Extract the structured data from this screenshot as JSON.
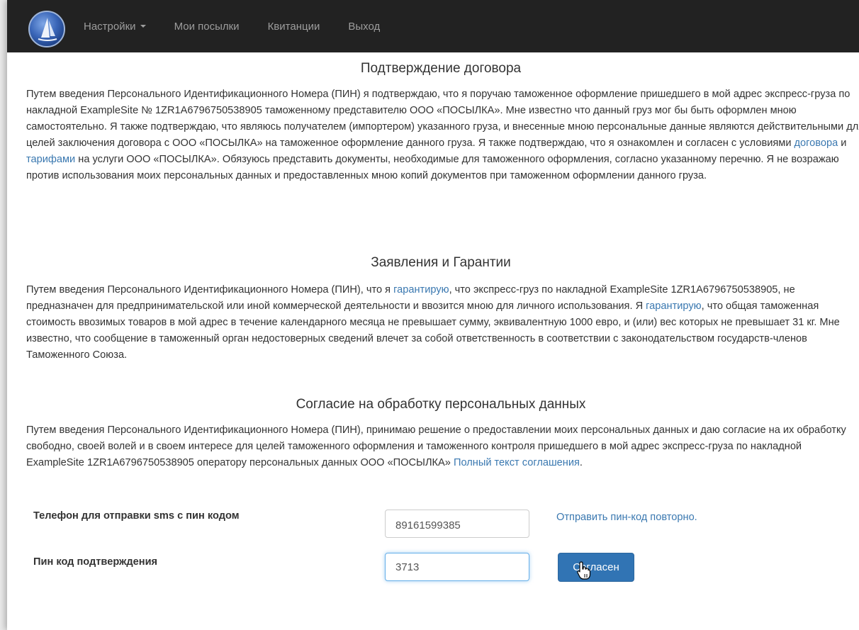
{
  "navbar": {
    "items": [
      {
        "label": "Настройки",
        "has_dropdown": true
      },
      {
        "label": "Мои посылки"
      },
      {
        "label": "Квитанции"
      },
      {
        "label": "Выход"
      }
    ]
  },
  "section1": {
    "title": "Подтверждение договора",
    "text_a": "Путем введения Персонального Идентификационного Номера (ПИН) я подтверждаю, что я поручаю таможенное оформление пришедшего в мой адрес экспресс-груза по накладной ExampleSite № 1ZR1A6796750538905 таможенному представителю ООО «ПОСЫЛКА». Мне известно что данный груз мог бы быть оформлен мною самостоятельно. Я также подтверждаю, что являюсь получателем (импортером) указанного груза, и внесенные мною персональные данные являются действительными для целей заключения договора с ООО «ПОСЫЛКА» на таможенное оформление данного груза. Я также подтверждаю, что я ознакомлен и согласен с условиями ",
    "link_contract": "договора",
    "text_b": " и ",
    "link_tariffs": "тарифами",
    "text_c": " на услуги ООО «ПОСЫЛКА». Обязуюсь представить документы, необходимые для таможенного оформления, согласно указанному перечню. Я не возражаю против использования моих персональных данных и предоставленных мною копий документов при таможенном оформлении данного груза."
  },
  "section2": {
    "title": "Заявления и Гарантии",
    "text_a": "Путем введения Персонального Идентификационного Номера (ПИН), что я ",
    "link_guarantee_1": "гарантирую",
    "text_b": ", что экспресс-груз по накладной ExampleSite 1ZR1A6796750538905, не предназначен для предпринимательской или иной коммерческой деятельности и ввозится мною для личного использования. Я ",
    "link_guarantee_2": "гарантирую",
    "text_c": ", что общая таможенная стоимость ввозимых товаров в мой адрес в течение календарного месяца не превышает сумму, эквивалентную 1000 евро, и (или) вес которых не превышает 31 кг. Мне известно, что сообщение в таможенный орган недостоверных сведений влечет за собой ответственность в соответствии с законодательством государств-членов Таможенного Союза."
  },
  "section3": {
    "title": "Согласие на обработку персональных данных",
    "text_a": "Путем введения Персонального Идентификационного Номера (ПИН), принимаю решение о предоставлении моих персональных данных и даю согласие на их обработку свободно, своей волей и в своем интересе для целей таможенного оформления и таможенного контроля пришедшего в мой адрес экспресс-груза по накладной ExampleSite 1ZR1A6796750538905 оператору персональных данных ООО «ПОСЫЛКА» ",
    "link_full_text": "Полный текст соглашения",
    "text_b": "."
  },
  "form": {
    "phone_label": "Телефон для отправки sms с пин кодом",
    "phone_value": "89161599385",
    "resend_link": "Отправить пин-код повторно.",
    "pin_label": "Пин код подтверждения",
    "pin_value": "3713",
    "submit_label": "Согласен"
  },
  "colors": {
    "navbar_bg": "#222222",
    "link": "#3a78b0",
    "button_primary": "#3174b4"
  }
}
